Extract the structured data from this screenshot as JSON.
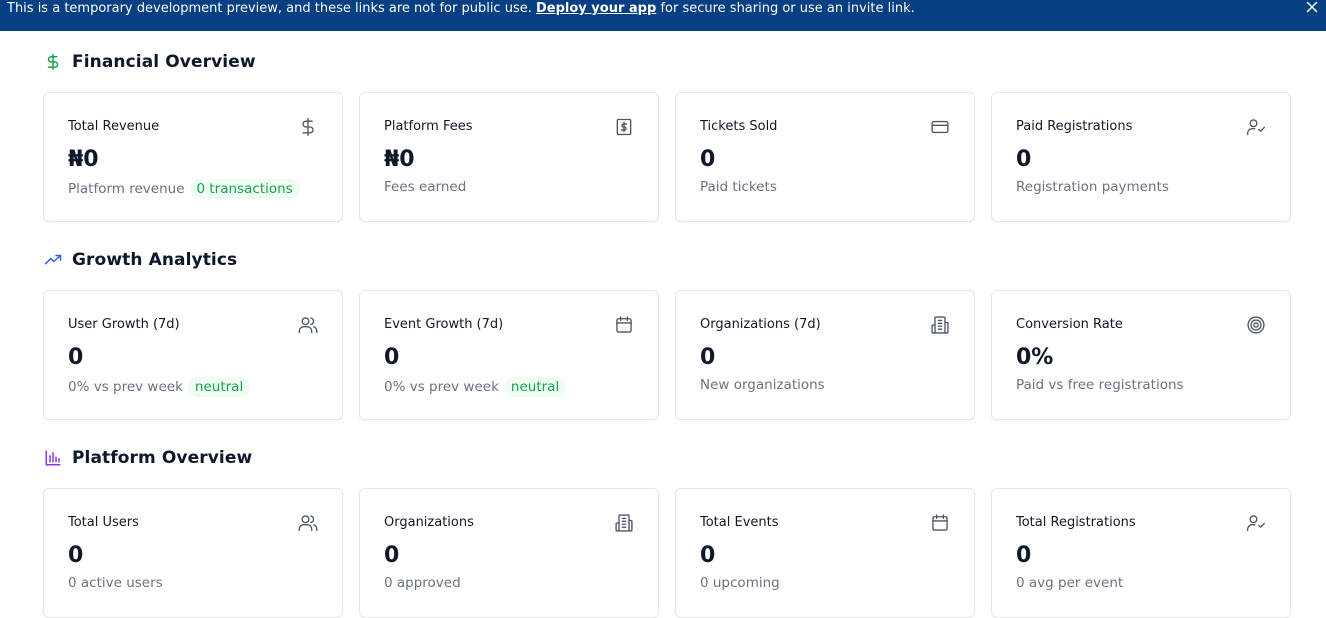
{
  "banner": {
    "text_before": "This is a temporary development preview, and these links are not for public use.",
    "link_label": "Deploy your app",
    "text_after": "for secure sharing or use an invite link.",
    "close_icon": "close-icon"
  },
  "colors": {
    "banner_bg": "#063f82",
    "financial_icon": "#16a34a",
    "growth_icon": "#2563eb",
    "platform_icon": "#9333ea",
    "pill_bg": "#f0fdf4",
    "pill_text": "#16a34a"
  },
  "financial": {
    "title": "Financial Overview",
    "icon": "dollar-icon",
    "cards": [
      {
        "label": "Total Revenue",
        "value": "₦0",
        "sub": "Platform revenue",
        "badge": "0 transactions",
        "icon": "dollar-icon"
      },
      {
        "label": "Platform Fees",
        "value": "₦0",
        "sub": "Fees earned",
        "icon": "receipt-icon"
      },
      {
        "label": "Tickets Sold",
        "value": "0",
        "sub": "Paid tickets",
        "icon": "credit-card-icon"
      },
      {
        "label": "Paid Registrations",
        "value": "0",
        "sub": "Registration payments",
        "icon": "user-check-icon"
      }
    ]
  },
  "growth": {
    "title": "Growth Analytics",
    "icon": "trending-up-icon",
    "cards": [
      {
        "label": "User Growth (7d)",
        "value": "0",
        "sub": "0% vs prev week",
        "badge": "neutral",
        "icon": "users-icon"
      },
      {
        "label": "Event Growth (7d)",
        "value": "0",
        "sub": "0% vs prev week",
        "badge": "neutral",
        "icon": "calendar-icon"
      },
      {
        "label": "Organizations (7d)",
        "value": "0",
        "sub": "New organizations",
        "icon": "building-icon"
      },
      {
        "label": "Conversion Rate",
        "value": "0%",
        "sub": "Paid vs free registrations",
        "icon": "target-icon"
      }
    ]
  },
  "platform": {
    "title": "Platform Overview",
    "icon": "bar-chart-icon",
    "cards": [
      {
        "label": "Total Users",
        "value": "0",
        "sub": "0 active users",
        "icon": "users-icon"
      },
      {
        "label": "Organizations",
        "value": "0",
        "sub": "0 approved",
        "icon": "building-icon"
      },
      {
        "label": "Total Events",
        "value": "0",
        "sub": "0 upcoming",
        "icon": "calendar-icon"
      },
      {
        "label": "Total Registrations",
        "value": "0",
        "sub": "0 avg per event",
        "icon": "user-check-icon"
      }
    ]
  }
}
